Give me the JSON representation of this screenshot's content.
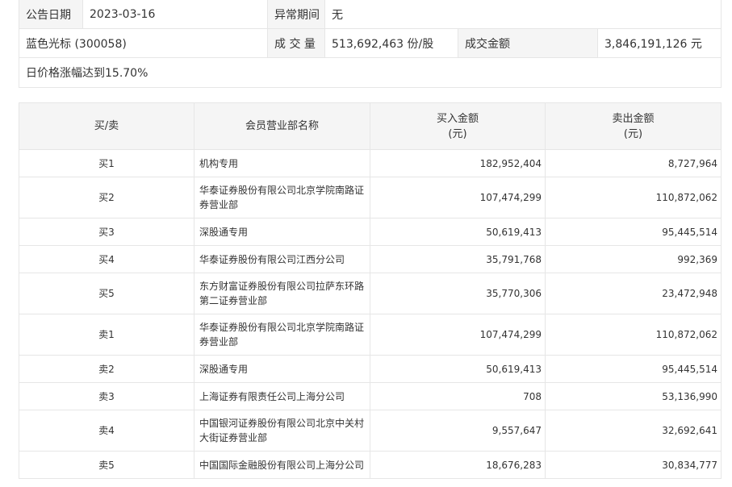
{
  "info": {
    "announce_date_label": "公告日期",
    "announce_date": "2023-03-16",
    "abnormal_period_label": "异常期间",
    "abnormal_period": "无",
    "stock": "蓝色光标 (300058)",
    "volume_label": "成 交 量",
    "volume": "513,692,463 份/股",
    "turnover_label": "成交金额",
    "turnover": "3,846,191,126 元",
    "reason": "日价格涨幅达到15.70%"
  },
  "table": {
    "headers": {
      "side": "买/卖",
      "dept": "会员营业部名称",
      "buy_line1": "买入金额",
      "buy_line2": "(元)",
      "sell_line1": "卖出金额",
      "sell_line2": "(元)"
    },
    "rows": [
      {
        "side": "买1",
        "dept": "机构专用",
        "buy": "182,952,404",
        "sell": "8,727,964"
      },
      {
        "side": "买2",
        "dept": "华泰证券股份有限公司北京学院南路证券营业部",
        "buy": "107,474,299",
        "sell": "110,872,062"
      },
      {
        "side": "买3",
        "dept": "深股通专用",
        "buy": "50,619,413",
        "sell": "95,445,514"
      },
      {
        "side": "买4",
        "dept": "华泰证券股份有限公司江西分公司",
        "buy": "35,791,768",
        "sell": "992,369"
      },
      {
        "side": "买5",
        "dept": "东方财富证券股份有限公司拉萨东环路第二证券营业部",
        "buy": "35,770,306",
        "sell": "23,472,948"
      },
      {
        "side": "卖1",
        "dept": "华泰证券股份有限公司北京学院南路证券营业部",
        "buy": "107,474,299",
        "sell": "110,872,062"
      },
      {
        "side": "卖2",
        "dept": "深股通专用",
        "buy": "50,619,413",
        "sell": "95,445,514"
      },
      {
        "side": "卖3",
        "dept": "上海证券有限责任公司上海分公司",
        "buy": "708",
        "sell": "53,136,990"
      },
      {
        "side": "卖4",
        "dept": "中国银河证券股份有限公司北京中关村大街证券营业部",
        "buy": "9,557,647",
        "sell": "32,692,641"
      },
      {
        "side": "卖5",
        "dept": "中国国际金融股份有限公司上海分公司",
        "buy": "18,676,283",
        "sell": "30,834,777"
      }
    ]
  }
}
